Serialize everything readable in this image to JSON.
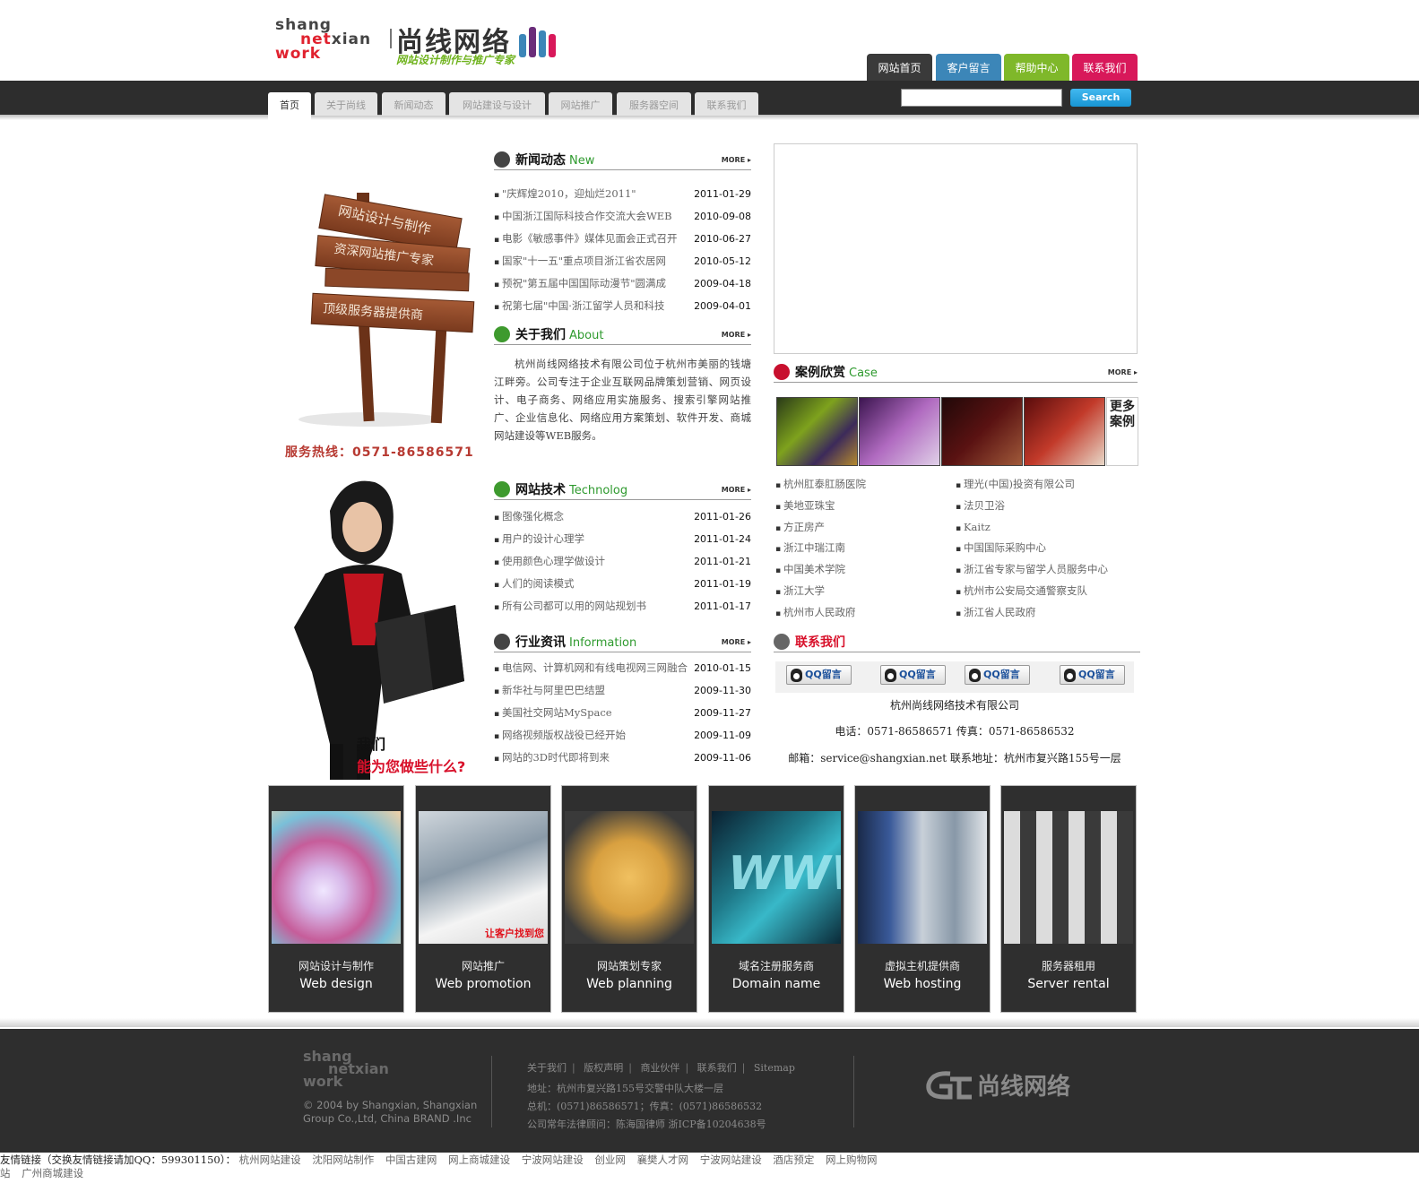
{
  "header": {
    "logo_en_1": "shang",
    "logo_en_2a": "net",
    "logo_en_2b": "xian",
    "logo_en_3": "work",
    "logo_cn": "尚线网络",
    "logo_sub": "网站设计制作与推广专家",
    "top_tabs": [
      {
        "label": "网站首页",
        "color": "#3a3a3a"
      },
      {
        "label": "客户留言",
        "color": "#3c86b8"
      },
      {
        "label": "帮助中心",
        "color": "#7fb82a"
      },
      {
        "label": "联系我们",
        "color": "#d8185a"
      }
    ]
  },
  "nav": {
    "tabs": [
      "首页",
      "关于尚线",
      "新闻动态",
      "网站建设与设计",
      "网站推广",
      "服务器空间",
      "联系我们"
    ],
    "search_placeholder": "",
    "search_label": "Search"
  },
  "left": {
    "hotline": "服务热线：0571-86586571",
    "we_line1": "我们",
    "we_line2": "能为您做些什么?"
  },
  "news": {
    "title_cn": "新闻动态",
    "title_en": "New",
    "more": "MORE",
    "items": [
      {
        "title": "\"庆辉煌2010，迎灿烂2011\"",
        "date": "2011-01-29"
      },
      {
        "title": "中国浙江国际科技合作交流大会WEB",
        "date": "2010-09-08"
      },
      {
        "title": "电影《敏感事件》媒体见面会正式召开",
        "date": "2010-06-27"
      },
      {
        "title": "国家\"十一五\"重点项目浙江省农居网",
        "date": "2010-05-12"
      },
      {
        "title": "预祝\"第五届中国国际动漫节\"圆满成",
        "date": "2009-04-18"
      },
      {
        "title": "祝第七届\"中国·浙江留学人员和科技",
        "date": "2009-04-01"
      }
    ]
  },
  "about": {
    "title_cn": "关于我们",
    "title_en": "About",
    "more": "MORE",
    "text": "杭州尚线网络技术有限公司位于杭州市美丽的钱塘江畔旁。公司专注于企业互联网品牌策划营销、网页设计、电子商务、网络应用实施服务、搜索引擎网站推广、企业信息化、网络应用方案策划、软件开发、商城网站建设等WEB服务。"
  },
  "tech": {
    "title_cn": "网站技术",
    "title_en": "Technolog",
    "more": "MORE",
    "items": [
      {
        "title": "图像强化概念",
        "date": "2011-01-26"
      },
      {
        "title": "用户的设计心理学",
        "date": "2011-01-24"
      },
      {
        "title": "使用颜色心理学做设计",
        "date": "2011-01-21"
      },
      {
        "title": "人们的阅读模式",
        "date": "2011-01-19"
      },
      {
        "title": "所有公司都可以用的网站规划书",
        "date": "2011-01-17"
      }
    ]
  },
  "industry": {
    "title_cn": "行业资讯",
    "title_en": "Information",
    "more": "MORE",
    "items": [
      {
        "title": "电信网、计算机网和有线电视网三网融合",
        "date": "2010-01-15"
      },
      {
        "title": "新华社与阿里巴巴结盟",
        "date": "2009-11-30"
      },
      {
        "title": "美国社交网站MySpace",
        "date": "2009-11-27"
      },
      {
        "title": "网络视频版权战役已经开始",
        "date": "2009-11-09"
      },
      {
        "title": "网站的3D时代即将到来",
        "date": "2009-11-06"
      }
    ]
  },
  "cases": {
    "title_cn": "案例欣赏",
    "title_en": "Case",
    "more": "MORE",
    "more_cases": "更多案例",
    "col1": [
      "杭州肛泰肛肠医院",
      "美地亚珠宝",
      "方正房产",
      "浙江中瑞江南",
      "中国美术学院",
      "浙江大学",
      "杭州市人民政府"
    ],
    "col2": [
      "理光(中国)投资有限公司",
      "法贝卫浴",
      "Kaitz",
      "中国国际采购中心",
      "浙江省专家与留学人员服务中心",
      "杭州市公安局交通警察支队",
      "浙江省人民政府"
    ]
  },
  "contact": {
    "title_cn": "联系我们",
    "qq_label": "QQ留言",
    "company": "杭州尚线网络技术有限公司",
    "phone": "电话：0571-86586571  传真：0571-86586532",
    "email_addr": "邮箱：service@shangxian.net    联系地址：杭州市复兴路155号一层"
  },
  "services": [
    {
      "cn": "网站设计与制作",
      "en": "Web design"
    },
    {
      "cn": "网站推广",
      "en": "Web promotion",
      "overlay": "让客户找到您"
    },
    {
      "cn": "网站策划专家",
      "en": "Web planning"
    },
    {
      "cn": "域名注册服务商",
      "en": "Domain name",
      "overlay": "WWW"
    },
    {
      "cn": "虚拟主机提供商",
      "en": "Web hosting"
    },
    {
      "cn": "服务器租用",
      "en": "Server rental"
    }
  ],
  "footer": {
    "copyright": "© 2004 by Shangxian, Shangxian Group Co.,Ltd, China BRAND .Inc",
    "links": [
      "关于我们",
      "版权声明",
      "商业伙伴",
      "联系我们",
      "Sitemap"
    ],
    "address": "地址：杭州市复兴路155号交警中队大楼一层",
    "phone": "总机：(0571)86586571；传真：(0571)86586532",
    "legal": "公司常年法律顾问：陈海国律师 浙ICP备10204638号",
    "brand": "尚线网络"
  },
  "friend_links": {
    "label": "友情链接（交换友情链接请加QQ：599301150）：",
    "links": [
      "杭州网站建设",
      "沈阳网站制作",
      "中国古建网",
      "网上商城建设",
      "宁波网站建设",
      "创业网",
      "襄樊人才网",
      "宁波网站建设",
      "酒店预定",
      "网上购物网站",
      "广州商城建设"
    ]
  }
}
